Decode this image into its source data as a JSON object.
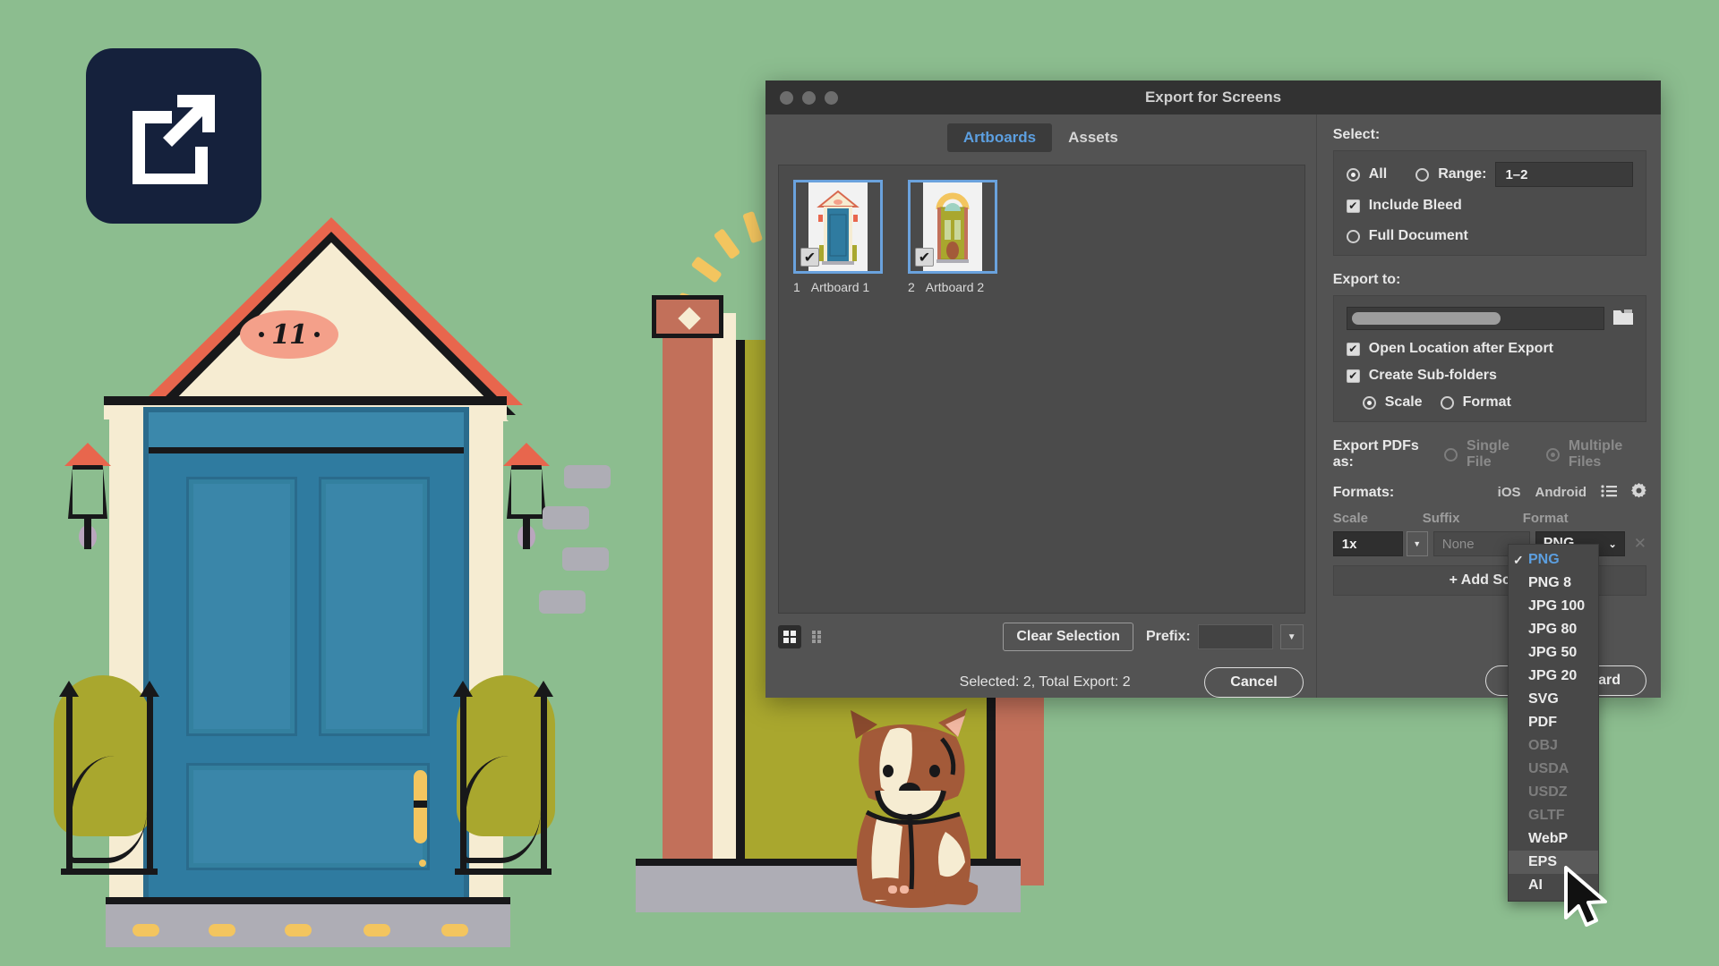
{
  "window": {
    "title": "Export for Screens",
    "traffic_lights": [
      "close-button",
      "minimize-button",
      "zoom-button"
    ]
  },
  "tabs": [
    {
      "label": "Artboards",
      "active": true
    },
    {
      "label": "Assets",
      "active": false
    }
  ],
  "artboards": [
    {
      "number": "1",
      "name": "Artboard 1",
      "checked": true
    },
    {
      "number": "2",
      "name": "Artboard 2",
      "checked": true
    }
  ],
  "select_section": {
    "label": "Select:",
    "all_label": "All",
    "all_selected": true,
    "range_label": "Range:",
    "range_selected": false,
    "range_value": "1–2",
    "include_bleed_label": "Include Bleed",
    "include_bleed_checked": true,
    "full_document_label": "Full Document",
    "full_document_selected": false
  },
  "export_to": {
    "label": "Export to:",
    "path_value": "",
    "folder_icon": "folder-icon",
    "open_location_label": "Open Location after Export",
    "open_location_checked": true,
    "create_subfolders_label": "Create Sub-folders",
    "create_subfolders_checked": true,
    "scale_label": "Scale",
    "scale_selected": true,
    "format_label": "Format",
    "format_selected": false
  },
  "export_pdfs": {
    "label": "Export PDFs as:",
    "single_file_label": "Single File",
    "single_file_selected": false,
    "multiple_files_label": "Multiple Files",
    "multiple_files_selected": true,
    "disabled": true
  },
  "formats": {
    "label": "Formats:",
    "presets": [
      "iOS",
      "Android"
    ],
    "icons": [
      "list-icon",
      "gear-icon"
    ],
    "columns": [
      "Scale",
      "Suffix",
      "Format"
    ],
    "rows": [
      {
        "scale": "1x",
        "suffix_placeholder": "None",
        "suffix_value": "",
        "format": "PNG"
      }
    ],
    "add_scale_label": "+ Add Scale"
  },
  "format_dropdown": {
    "open": true,
    "selected": "PNG",
    "hovered": "EPS",
    "items": [
      {
        "label": "PNG",
        "enabled": true,
        "checked": true
      },
      {
        "label": "PNG 8",
        "enabled": true,
        "checked": false
      },
      {
        "label": "JPG 100",
        "enabled": true,
        "checked": false
      },
      {
        "label": "JPG 80",
        "enabled": true,
        "checked": false
      },
      {
        "label": "JPG 50",
        "enabled": true,
        "checked": false
      },
      {
        "label": "JPG 20",
        "enabled": true,
        "checked": false
      },
      {
        "label": "SVG",
        "enabled": true,
        "checked": false
      },
      {
        "label": "PDF",
        "enabled": true,
        "checked": false
      },
      {
        "label": "OBJ",
        "enabled": false,
        "checked": false
      },
      {
        "label": "USDA",
        "enabled": false,
        "checked": false
      },
      {
        "label": "USDZ",
        "enabled": false,
        "checked": false
      },
      {
        "label": "GLTF",
        "enabled": false,
        "checked": false
      },
      {
        "label": "WebP",
        "enabled": true,
        "checked": false
      },
      {
        "label": "EPS",
        "enabled": true,
        "checked": false
      },
      {
        "label": "AI",
        "enabled": true,
        "checked": false
      }
    ]
  },
  "bottom_bar": {
    "view_grid_icon": "grid-view-icon",
    "view_list_icon": "detail-view-icon",
    "clear_selection_label": "Clear Selection",
    "prefix_label": "Prefix:",
    "prefix_value": "",
    "status": "Selected: 2, Total Export: 2",
    "cancel_label": "Cancel",
    "export_label": "Export Artboard"
  },
  "illustration": {
    "badge_icon": "export-external-link-icon",
    "house_number": "11",
    "colors": {
      "background": "#8cbd8f",
      "badge": "#15213c",
      "door_blue": "#2f7ba0",
      "door_olive": "#a9a72e",
      "cream": "#f6ecd2",
      "roof_red": "#e8664d",
      "brick": "#c2705a",
      "step_gray": "#aeadb5",
      "handle_yellow": "#f3c55f",
      "plaque": "#f4a08a",
      "dog_brown": "#a35a39"
    }
  },
  "cursor": {
    "icon": "arrow-cursor"
  }
}
